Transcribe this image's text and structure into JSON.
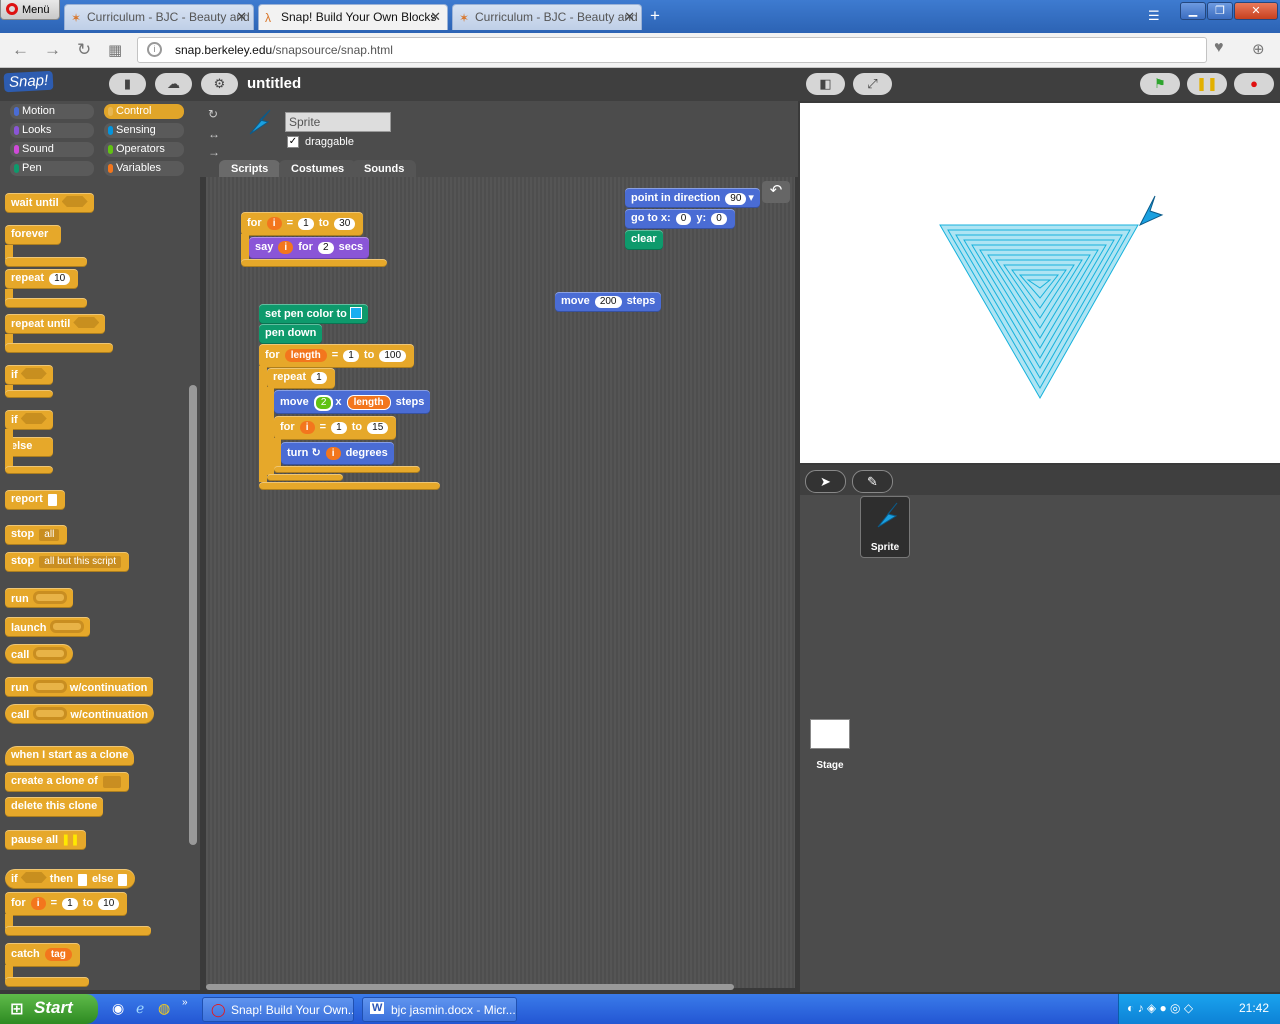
{
  "browser": {
    "menu_label": "Menü",
    "tabs": [
      {
        "title": "Curriculum - BJC - Beauty and Joy of Computing",
        "active": false
      },
      {
        "title": "Snap! Build Your Own Blocks",
        "active": true
      },
      {
        "title": "Curriculum - BJC - Beauty and Joy of Computing",
        "active": false
      }
    ],
    "new_tab_label": "+",
    "url_host": "snap.berkeley.edu",
    "url_path": "/snapsource/snap.html"
  },
  "snap": {
    "logo": "Snap!",
    "project_title": "untitled",
    "categories": [
      {
        "label": "Motion",
        "color": "#4a6cd4"
      },
      {
        "label": "Control",
        "color": "#e6a82a",
        "selected": true
      },
      {
        "label": "Looks",
        "color": "#8a55d7"
      },
      {
        "label": "Sensing",
        "color": "#0494dc"
      },
      {
        "label": "Sound",
        "color": "#cf4ad9"
      },
      {
        "label": "Operators",
        "color": "#62c213"
      },
      {
        "label": "Pen",
        "color": "#0e9a6c"
      },
      {
        "label": "Variables",
        "color": "#f3761d"
      }
    ],
    "palette": {
      "wait_until": "wait until",
      "forever": "forever",
      "repeat": "repeat",
      "repeat_count": "10",
      "repeat_until": "repeat until",
      "if": "if",
      "else": "else",
      "report": "report",
      "stop": "stop",
      "stop_all": "all",
      "stop_others": "all but this script",
      "run": "run",
      "launch": "launch",
      "call": "call",
      "run_cont": "w/continuation",
      "call_cont": "w/continuation",
      "when_clone": "when I start as a clone",
      "create_clone": "create a clone of",
      "delete_clone": "delete this clone",
      "pause_all": "pause all",
      "if_then_else": {
        "a": "if",
        "b": "then",
        "c": "else"
      },
      "for": "for",
      "for_var": "i",
      "for_from": "1",
      "for_to_word": "to",
      "for_to": "10",
      "eq": "=",
      "catch": "catch",
      "tag": "tag"
    },
    "sprite": {
      "name": "Sprite",
      "draggable_label": "draggable"
    },
    "tabs": [
      "Scripts",
      "Costumes",
      "Sounds"
    ],
    "scripts": {
      "s1": {
        "for": "for",
        "var": "i",
        "eq": "=",
        "from": "1",
        "to_word": "to",
        "to": "30",
        "say": "say",
        "for2": "for",
        "secs_n": "2",
        "secs": "secs"
      },
      "s2": {
        "point": "point in direction",
        "dir": "90",
        "goto": "go to x:",
        "x": "0",
        "yword": "y:",
        "y": "0",
        "clear": "clear"
      },
      "s3": {
        "move": "move",
        "n": "200",
        "steps": "steps"
      },
      "s4": {
        "setpen": "set pen color to",
        "pendown": "pen down",
        "for": "for",
        "var": "length",
        "eq": "=",
        "from": "1",
        "to_word": "to",
        "to": "100",
        "repeat": "repeat",
        "rep_n": "1",
        "move": "move",
        "mul_a": "2",
        "mul_op": "x",
        "mul_b": "length",
        "steps": "steps",
        "for2": "for",
        "var2": "i",
        "from2": "1",
        "to2": "15",
        "turn": "turn",
        "turn_var": "i",
        "degrees": "degrees"
      }
    },
    "corral": {
      "sprite_label": "Sprite",
      "stage_label": "Stage"
    }
  },
  "taskbar": {
    "start": "Start",
    "items": [
      "Snap! Build Your Own...",
      "bjc jasmin.docx - Micr..."
    ],
    "clock": "21:42"
  }
}
